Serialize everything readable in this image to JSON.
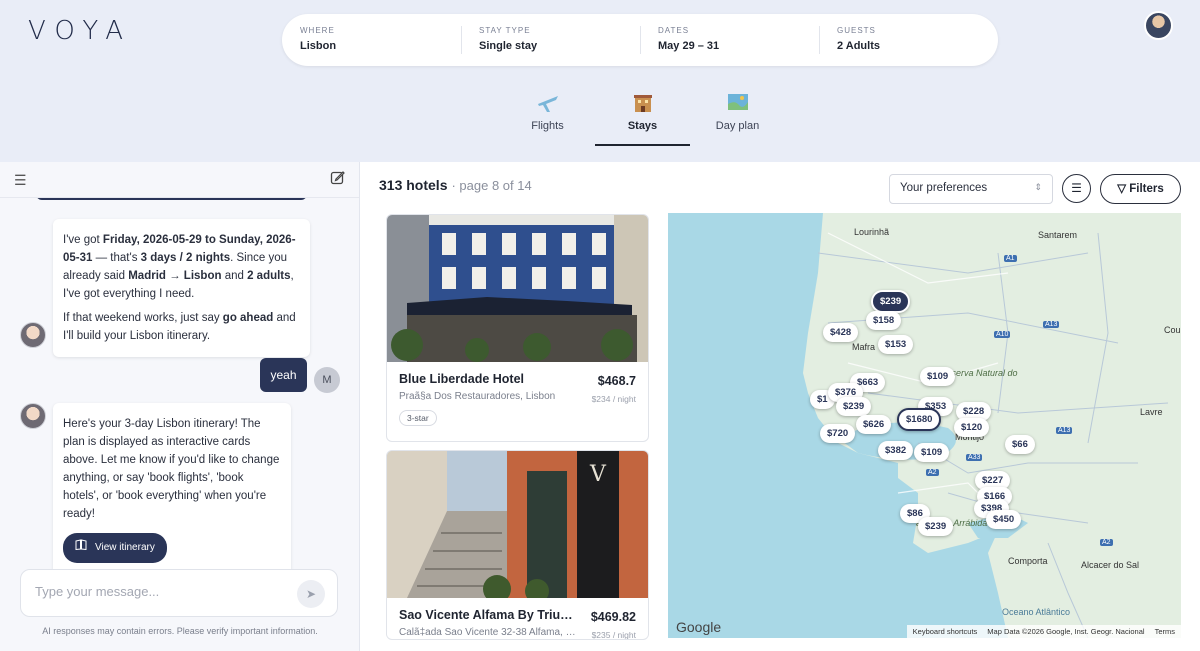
{
  "brand": "VOYA",
  "search": {
    "segments": [
      {
        "label": "WHERE",
        "value": "Lisbon"
      },
      {
        "label": "STAY TYPE",
        "value": "Single stay"
      },
      {
        "label": "DATES",
        "value": "May 29 – 31"
      },
      {
        "label": "GUESTS",
        "value": "2 Adults"
      }
    ]
  },
  "tabs": [
    {
      "label": "Flights",
      "icon": "airplane-icon"
    },
    {
      "label": "Stays",
      "icon": "hotel-icon",
      "active": true
    },
    {
      "label": "Day plan",
      "icon": "map-icon"
    }
  ],
  "chat": {
    "bot_msg1": {
      "p1_a": "I've got ",
      "p1_b": "Friday, 2026-05-29 to Sunday, 2026-05-31",
      "p1_c": " — that's ",
      "p1_d": "3 days / 2 nights",
      "p1_e": ". Since you already said ",
      "p1_f": "Madrid → Lisbon",
      "p1_g": " and ",
      "p1_h": "2 adults",
      "p1_i": ", I've got everything I need.",
      "p2_a": "If that weekend works, just say ",
      "p2_b": "go ahead",
      "p2_c": " and I'll build your Lisbon itinerary."
    },
    "user_msg": "yeah",
    "user_initial": "M",
    "bot_msg2": "Here's your 3-day Lisbon itinerary! The plan is displayed as interactive cards above. Let me know if you'd like to change anything, or say 'book flights', 'book hotels', or 'book everything' when you're ready!",
    "itinerary_button": "View itinerary",
    "input_placeholder": "Type your message...",
    "disclaimer": "AI responses may contain errors. Please verify important information."
  },
  "results": {
    "count": "313 hotels",
    "page": "· page 8 of 14",
    "sort_label": "Your preferences",
    "filters_label": "Filters"
  },
  "hotels": [
    {
      "name": "Blue Liberdade Hotel",
      "price": "$468.7",
      "address": "Praã§a Dos Restauradores, Lisbon",
      "per_night": "$234 / night",
      "badge": "3-star"
    },
    {
      "name": "Sao Vicente Alfama By Trius Hot...",
      "price": "$469.82",
      "address": "Calã‡ada Sao Vicente 32-38 Alfama, L...",
      "per_night": "$235 / night"
    }
  ],
  "map": {
    "places": [
      "Lourinhã",
      "Santarem",
      "Mafra",
      "Lavre",
      "Comporta",
      "Alcacer do Sal",
      "Oceano Atlântico",
      "Cou",
      "Reserva Natural do",
      "atural da Arrábida",
      "Montijo"
    ],
    "roads": [
      "A1",
      "A13",
      "A10",
      "A13",
      "A2",
      "A33",
      "A2"
    ],
    "pins": [
      "$239",
      "$158",
      "$428",
      "$153",
      "$109",
      "$663",
      "$376",
      "$239",
      "$353",
      "$228",
      "$626",
      "$1680",
      "$120",
      "$720",
      "$382",
      "$109",
      "$66",
      "$227",
      "$166",
      "$398",
      "$450",
      "$86",
      "$239",
      "$1"
    ],
    "google": "Google",
    "attribution": [
      "Keyboard shortcuts",
      "Map Data ©2026 Google, Inst. Geogr. Nacional",
      "Terms"
    ]
  }
}
